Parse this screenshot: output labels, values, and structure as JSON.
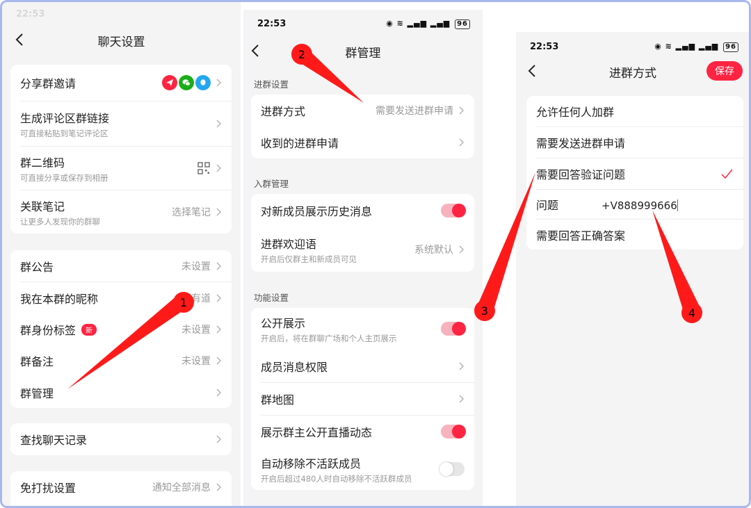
{
  "panel1": {
    "title": "聊天设置",
    "share_invite": {
      "label": "分享群邀请"
    },
    "comment_link": {
      "label": "生成评论区群链接",
      "sub": "可直接粘贴到笔记评论区"
    },
    "qrcode": {
      "label": "群二维码",
      "sub": "可直接分享或保存到相册"
    },
    "linked_note": {
      "label": "关联笔记",
      "sub": "让更多人发现你的群聊",
      "value": "选择笔记"
    },
    "announcement": {
      "label": "群公告",
      "value": "未设置"
    },
    "nickname": {
      "label": "我在本群的昵称",
      "value": "唐有道"
    },
    "identity_tag": {
      "label": "群身份标签",
      "badge": "新",
      "value": "未设置"
    },
    "remark": {
      "label": "群备注",
      "value": "未设置"
    },
    "manage": {
      "label": "群管理"
    },
    "search_history": {
      "label": "查找聊天记录"
    },
    "dnd": {
      "label": "免打扰设置",
      "value": "通知全部消息"
    }
  },
  "panel2": {
    "time": "22:53",
    "battery": "96",
    "title": "群管理",
    "section_join": "进群设置",
    "join_method": {
      "label": "进群方式",
      "value": "需要发送进群申请"
    },
    "received_requests": {
      "label": "收到的进群申请"
    },
    "section_entry": "入群管理",
    "show_history": {
      "label": "对新成员展示历史消息",
      "on": true
    },
    "welcome": {
      "label": "进群欢迎语",
      "sub": "开启后仅群主和新成员可见",
      "value": "系统默认"
    },
    "section_func": "功能设置",
    "public_display": {
      "label": "公开展示",
      "sub": "开启后，将在群聊广场和个人主页展示",
      "on": true
    },
    "member_perm": {
      "label": "成员消息权限"
    },
    "group_map": {
      "label": "群地图"
    },
    "live_feed": {
      "label": "展示群主公开直播动态",
      "on": true
    },
    "auto_remove": {
      "label": "自动移除不活跃成员",
      "sub": "开启后超过480人时自动移除不活跃群成员",
      "on": false
    }
  },
  "panel3": {
    "time": "22:53",
    "battery": "96",
    "title": "进群方式",
    "save_label": "保存",
    "options": [
      {
        "label": "允许任何人加群"
      },
      {
        "label": "需要发送进群申请"
      },
      {
        "label": "需要回答验证问题",
        "checked": true
      },
      {
        "label": "问题",
        "input_value": "+V888999666"
      },
      {
        "label": "需要回答正确答案"
      }
    ]
  },
  "annotations": [
    "1",
    "2",
    "3",
    "4"
  ],
  "colors": {
    "accent": "#ff2442",
    "arrow": "#ff1a1a",
    "background": "#f4f4f5",
    "frame": "#a9b8ec"
  },
  "icons": {
    "back": "chevron-left-icon",
    "chevron": "chevron-right-icon",
    "share_channels": [
      "send-icon",
      "wechat-icon",
      "qq-icon"
    ],
    "qr": "qrcode-icon",
    "check": "check-icon"
  }
}
